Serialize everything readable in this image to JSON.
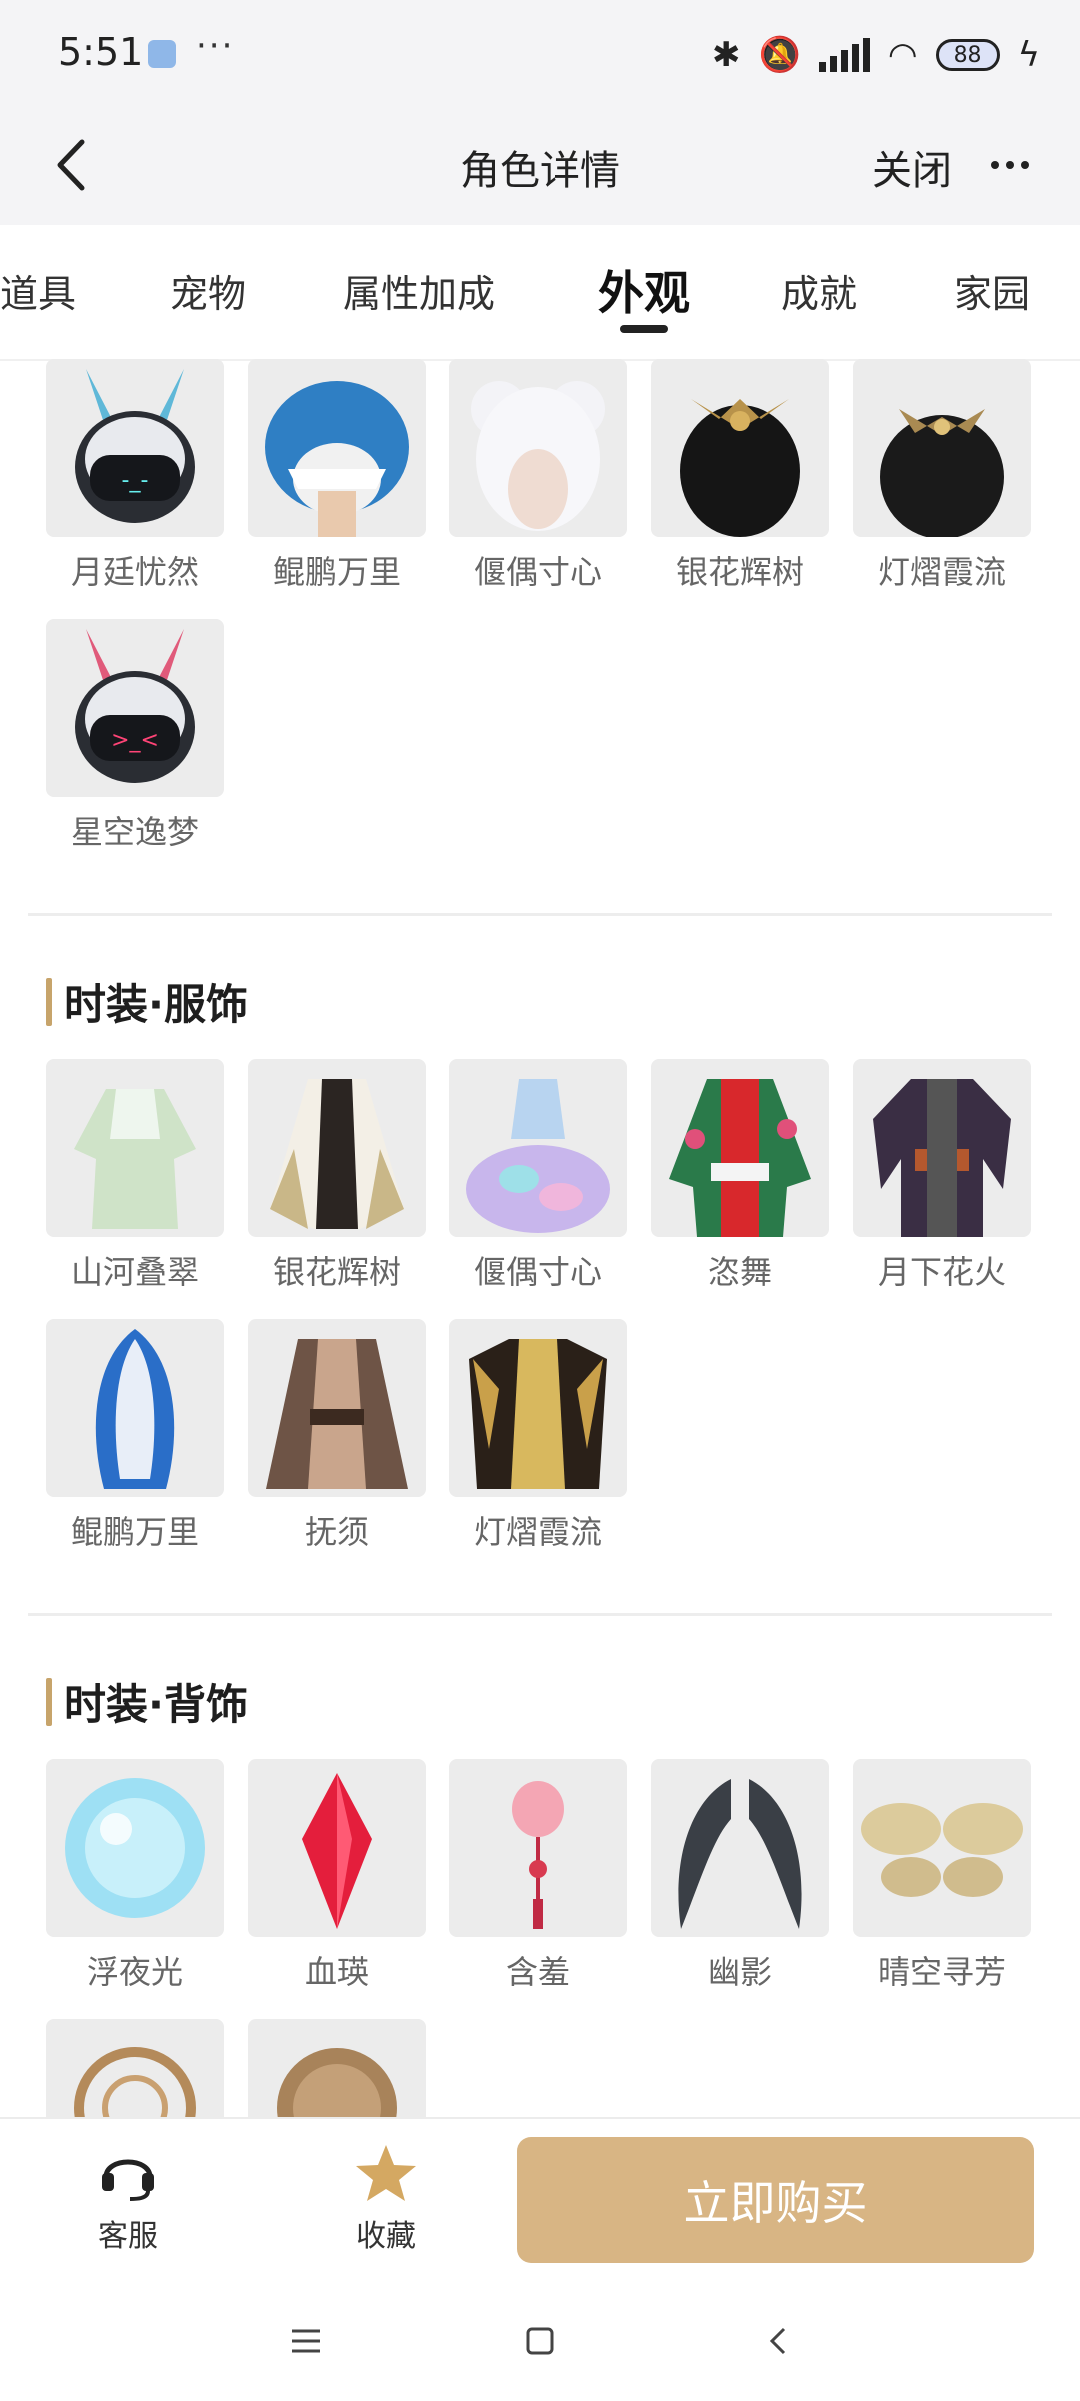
{
  "status": {
    "time": "5:51",
    "dots": "···",
    "battery": "88"
  },
  "header": {
    "title": "角色详情",
    "close": "关闭"
  },
  "tabs": [
    {
      "label": "道具"
    },
    {
      "label": "宠物"
    },
    {
      "label": "属性加成"
    },
    {
      "label": "外观"
    },
    {
      "label": "成就"
    },
    {
      "label": "家园"
    }
  ],
  "active_tab": "外观",
  "head_items": [
    {
      "name": "月廷忧然"
    },
    {
      "name": "鲲鹏万里"
    },
    {
      "name": "偃偶寸心"
    },
    {
      "name": "银花辉树"
    },
    {
      "name": "灯熠霞流"
    },
    {
      "name": "星空逸梦"
    }
  ],
  "sections": [
    {
      "title": "时装·服饰",
      "items": [
        {
          "name": "山河叠翠"
        },
        {
          "name": "银花辉树"
        },
        {
          "name": "偃偶寸心"
        },
        {
          "name": "恣舞"
        },
        {
          "name": "月下花火"
        },
        {
          "name": "鲲鹏万里"
        },
        {
          "name": "抚须"
        },
        {
          "name": "灯熠霞流"
        }
      ]
    },
    {
      "title": "时装·背饰",
      "items": [
        {
          "name": "浮夜光"
        },
        {
          "name": "血瑛"
        },
        {
          "name": "含羞"
        },
        {
          "name": "幽影"
        },
        {
          "name": "晴空寻芳"
        }
      ]
    }
  ],
  "bottom": {
    "service": "客服",
    "favorite": "收藏",
    "buy": "立即购买"
  },
  "colors": {
    "accent": "#d8b584",
    "section_bar": "#c7a46b",
    "tile_bg": "#ececec"
  }
}
